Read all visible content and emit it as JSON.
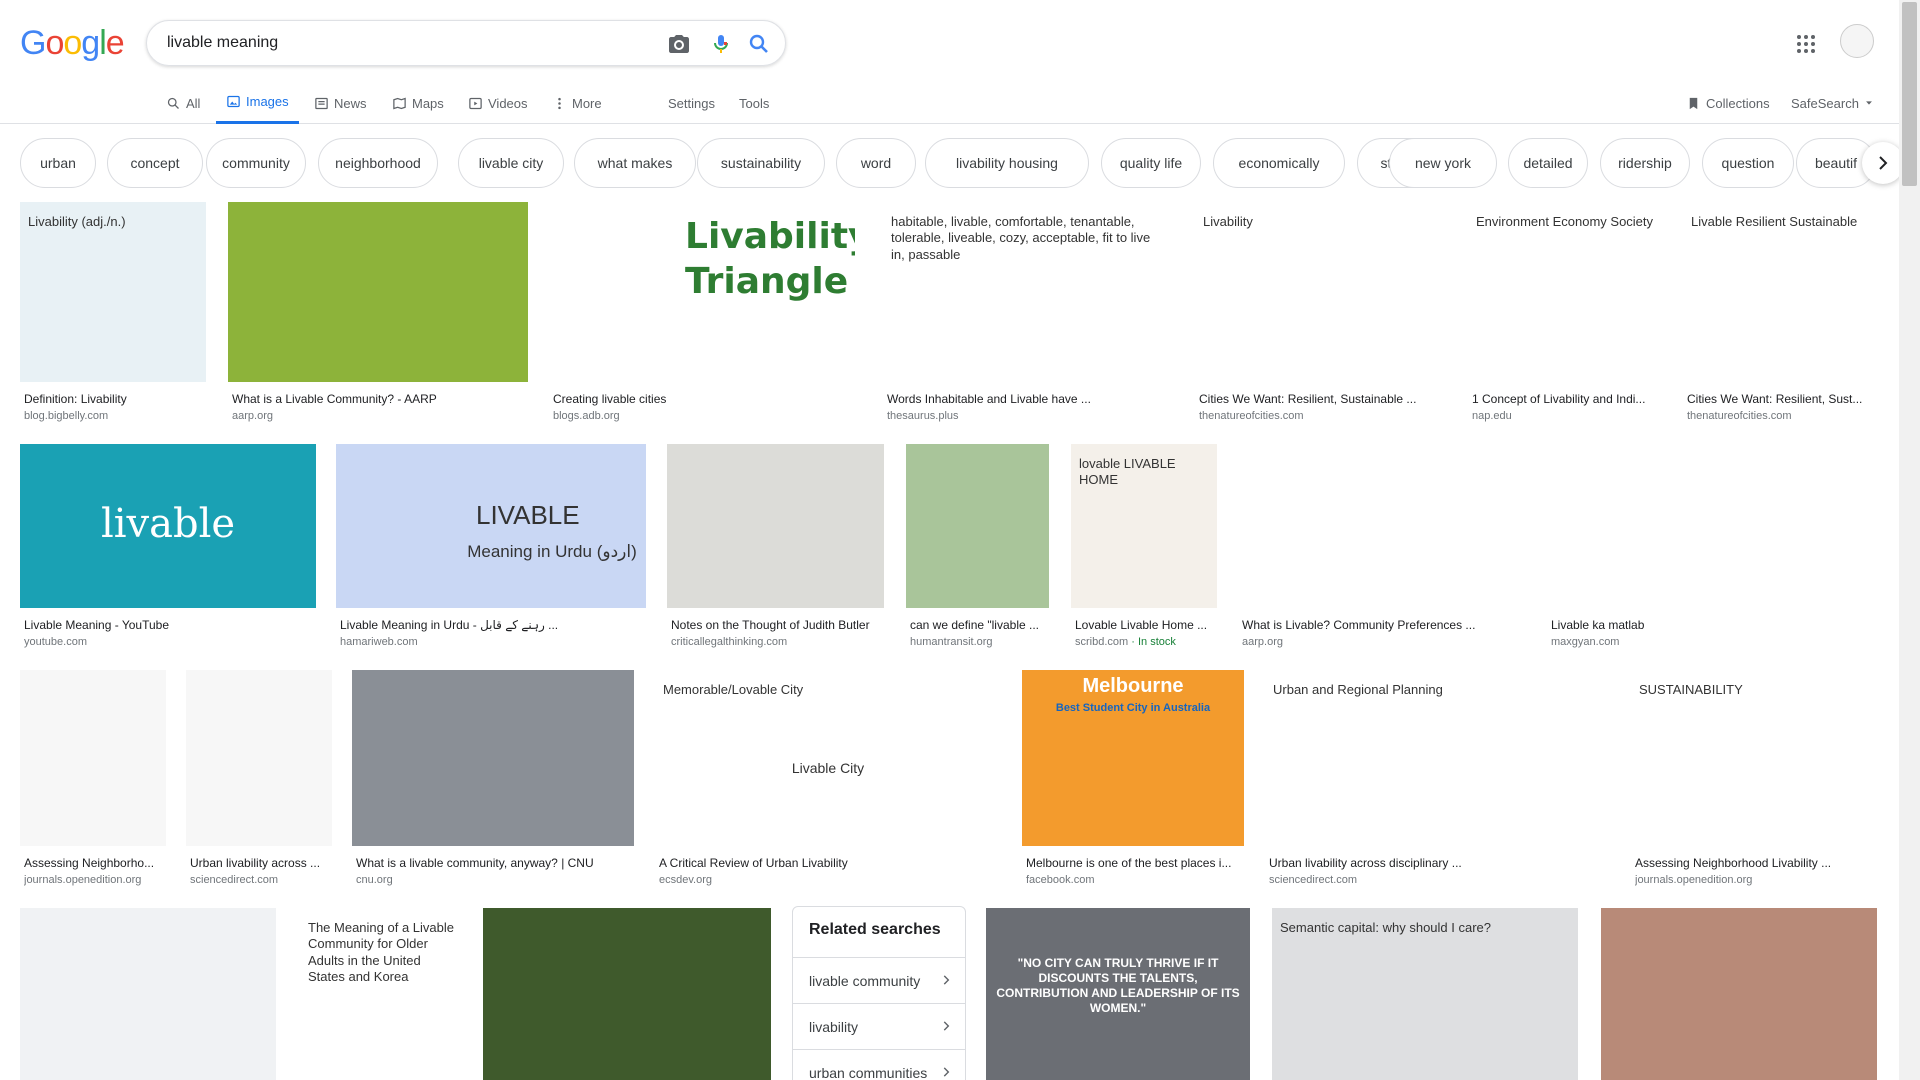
{
  "header": {
    "logo_letters": [
      {
        "ch": "G",
        "color": "#4285f4"
      },
      {
        "ch": "o",
        "color": "#ea4335"
      },
      {
        "ch": "o",
        "color": "#fbbc05"
      },
      {
        "ch": "g",
        "color": "#4285f4"
      },
      {
        "ch": "l",
        "color": "#34a853"
      },
      {
        "ch": "e",
        "color": "#ea4335"
      }
    ],
    "search_value": "livable meaning",
    "icons": [
      "camera-icon",
      "mic-icon",
      "search-icon",
      "apps-icon"
    ]
  },
  "tabs": [
    {
      "label": "All",
      "icon": "search-icon",
      "active": false
    },
    {
      "label": "Images",
      "icon": "image-icon",
      "active": true
    },
    {
      "label": "News",
      "icon": "news-icon",
      "active": false
    },
    {
      "label": "Maps",
      "icon": "map-icon",
      "active": false
    },
    {
      "label": "Videos",
      "icon": "video-icon",
      "active": false
    },
    {
      "label": "More",
      "icon": "more-icon",
      "active": false
    },
    {
      "label": "Settings",
      "icon": "",
      "active": false
    },
    {
      "label": "Tools",
      "icon": "",
      "active": false
    }
  ],
  "right_tabs": {
    "collections": "Collections",
    "safesearch": "SafeSearch"
  },
  "chips": [
    "urban",
    "concept",
    "community",
    "neighborhood",
    "livable city",
    "what makes",
    "sustainability",
    "word",
    "livability housing",
    "quality life",
    "economically",
    "street",
    "new york",
    "detailed",
    "ridership",
    "question",
    "beautif"
  ],
  "results": [
    {
      "caption": "Definition: Livability",
      "source": "blog.bigbelly.com",
      "img_text": "Livability (adj./n.)",
      "bg": "#e8f1f5"
    },
    {
      "caption": "What is a Livable Community? - AARP",
      "source": "aarp.org",
      "img_text": "",
      "bg": "#8db33a"
    },
    {
      "caption": "Creating livable cities",
      "source": "blogs.adb.org",
      "img_text": "Livability Triangle",
      "bg": "#ffffff"
    },
    {
      "caption": "Words Inhabitable and Livable have ...",
      "source": "thesaurus.plus",
      "img_text": "habitable, livable, comfortable, tenantable, tolerable, liveable, cozy, acceptable, fit to live in, passable",
      "bg": "#ffffff"
    },
    {
      "caption": "Cities We Want: Resilient, Sustainable ...",
      "source": "thenatureofcities.com",
      "img_text": "Livability",
      "bg": "#ffffff"
    },
    {
      "caption": "1 Concept of Livability and Indi...",
      "source": "nap.edu",
      "img_text": "Environment Economy Society",
      "bg": "#ffffff"
    },
    {
      "caption": "Cities We Want: Resilient, Sust...",
      "source": "thenatureofcities.com",
      "img_text": "Livable Resilient Sustainable",
      "bg": "#ffffff"
    },
    {
      "caption": "Livable Meaning - YouTube",
      "source": "youtube.com",
      "img_text": "livable",
      "bg": "#1aa1b4"
    },
    {
      "caption": "Livable Meaning in Urdu - رہنے کے قابل ...",
      "source": "hamariweb.com",
      "img_text": "LIVABLE",
      "sub_text": "Meaning in Urdu (اردو)",
      "bg": "#c9d7f4"
    },
    {
      "caption": "Notes on the Thought of Judith Butler",
      "source": "criticallegalthinking.com",
      "img_text": "",
      "bg": "#dcdcd8"
    },
    {
      "caption": "can we define \"livable ...",
      "source": "humantransit.org",
      "img_text": "",
      "bg": "#a9c59a"
    },
    {
      "caption": "Lovable Livable Home ...",
      "source": "scribd.com",
      "stock": "In stock",
      "img_text": "lovable LIVABLE HOME",
      "bg": "#f4f0ea"
    },
    {
      "caption": "What is Livable? Community Preferences ...",
      "source": "aarp.org",
      "img_text": "",
      "bg": "#ffffff"
    },
    {
      "caption": "Livable ka matlab",
      "source": "maxgyan.com",
      "img_text": "",
      "bg": "#ffffff"
    },
    {
      "caption": "Assessing Neighborho...",
      "source": "journals.openedition.org",
      "img_text": "",
      "bg": "#f7f7f7"
    },
    {
      "caption": "Urban livability across ...",
      "source": "sciencedirect.com",
      "img_text": "",
      "bg": "#f7f7f7"
    },
    {
      "caption": "What is a livable community, anyway? | CNU",
      "source": "cnu.org",
      "img_text": "",
      "bg": "#8a8f96"
    },
    {
      "caption": "A Critical Review of Urban Livability",
      "source": "ecsdev.org",
      "img_text": "Memorable/Lovable City",
      "sub_text": "Livable City",
      "bg": "#ffffff"
    },
    {
      "caption": "Melbourne is one of the best places i...",
      "source": "facebook.com",
      "img_text": "Melbourne",
      "sub_text": "Best Student City in Australia",
      "bg": "#f39b2d"
    },
    {
      "caption": "Urban livability across disciplinary ...",
      "source": "sciencedirect.com",
      "img_text": "Urban and Regional Planning",
      "bg": "#ffffff"
    },
    {
      "caption": "Assessing Neighborhood Livability ...",
      "source": "journals.openedition.org",
      "img_text": "SUSTAINABILITY",
      "bg": "#ffffff"
    },
    {
      "caption": "",
      "source": "",
      "img_text": "",
      "bg": "#f0f2f4"
    },
    {
      "caption": "",
      "source": "",
      "img_text": "The Meaning of a Livable Community for Older Adults in the United States and Korea",
      "bg": "#ffffff"
    },
    {
      "caption": "",
      "source": "",
      "img_text": "",
      "bg": "#3f5a2c"
    },
    {
      "caption": "",
      "source": "",
      "img_text": "\"NO CITY CAN TRULY THRIVE IF IT DISCOUNTS THE TALENTS, CONTRIBUTION AND LEADERSHIP OF ITS WOMEN.\"",
      "bg": "#6b6e74"
    },
    {
      "caption": "",
      "source": "",
      "img_text": "Semantic capital: why should I care?",
      "bg": "#dedfe1"
    },
    {
      "caption": "",
      "source": "",
      "img_text": "",
      "bg": "#b88a78"
    }
  ],
  "related": {
    "title": "Related searches",
    "items": [
      "livable community",
      "livability",
      "urban communities"
    ]
  }
}
